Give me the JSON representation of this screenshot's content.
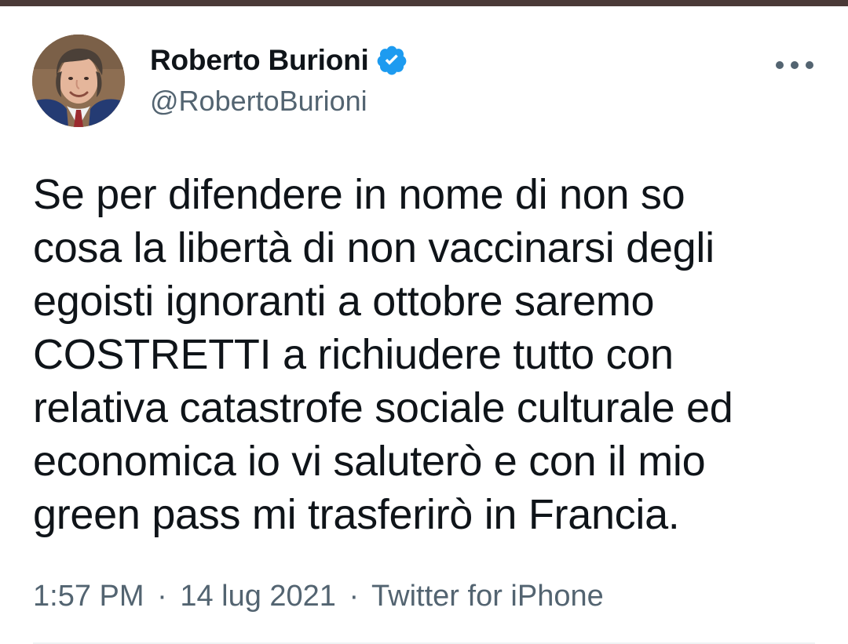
{
  "author": {
    "display_name": "Roberto Burioni",
    "handle": "@RobertoBurioni",
    "verified": true,
    "avatar_icon": "profile-photo"
  },
  "menu": {
    "more_icon": "more-horizontal-icon"
  },
  "tweet": {
    "text": "Se per difendere in nome di non so\ncosa la libertà di non vaccinarsi degli\negoisti ignoranti a ottobre saremo\nCOSTRETTI a richiudere tutto con\nrelativa catastrofe sociale culturale ed\neconomica io vi saluterò e con il mio\ngreen pass mi trasferirò in Francia.",
    "time": "1:57 PM",
    "date": "14 lug 2021",
    "source": "Twitter for iPhone",
    "separator": "·"
  },
  "colors": {
    "text_primary": "#0f1419",
    "text_secondary": "#536471",
    "verified_blue": "#1d9bf0",
    "top_bar": "#4a3a37"
  }
}
